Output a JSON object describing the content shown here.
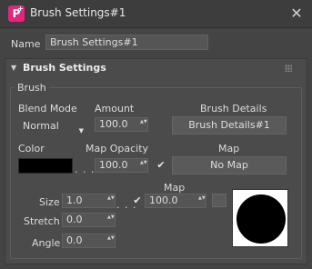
{
  "window": {
    "title": "Brush Settings#1",
    "app_icon_letter": "P",
    "app_icon_plus": "+",
    "close_glyph": "✕"
  },
  "name_row": {
    "label": "Name",
    "value": "Brush Settings#1"
  },
  "panel": {
    "title": "Brush Settings",
    "collapse_glyph": "▼",
    "group_title": "Brush",
    "blend_mode": {
      "label": "Blend Mode",
      "value": "Normal",
      "caret": "▼"
    },
    "amount": {
      "label": "Amount",
      "value": "100.0"
    },
    "brush_details": {
      "label": "Brush Details",
      "button": "Brush Details#1"
    },
    "color": {
      "label": "Color",
      "value_hex": "#000000"
    },
    "map_opacity": {
      "label": "Map Opacity",
      "value": "100.0",
      "checked": true
    },
    "map": {
      "label": "Map",
      "button": "No Map"
    },
    "size": {
      "label": "Size",
      "value": "1.0",
      "checked": true,
      "map_label": "Map",
      "map_value": "100.0"
    },
    "stretch": {
      "label": "Stretch",
      "value": "0.0"
    },
    "angle": {
      "label": "Angle",
      "value": "0.0"
    },
    "ellipsis": ". . .",
    "spinner_arrows": "▲▼",
    "check_glyph": "✔"
  },
  "colors": {
    "window_bg": "#444444",
    "panel_bg": "#4b4b4b",
    "field_bg": "#555555",
    "app_icon": "#e4257c",
    "preview_bg": "#ffffff",
    "preview_brush": "#000000"
  }
}
